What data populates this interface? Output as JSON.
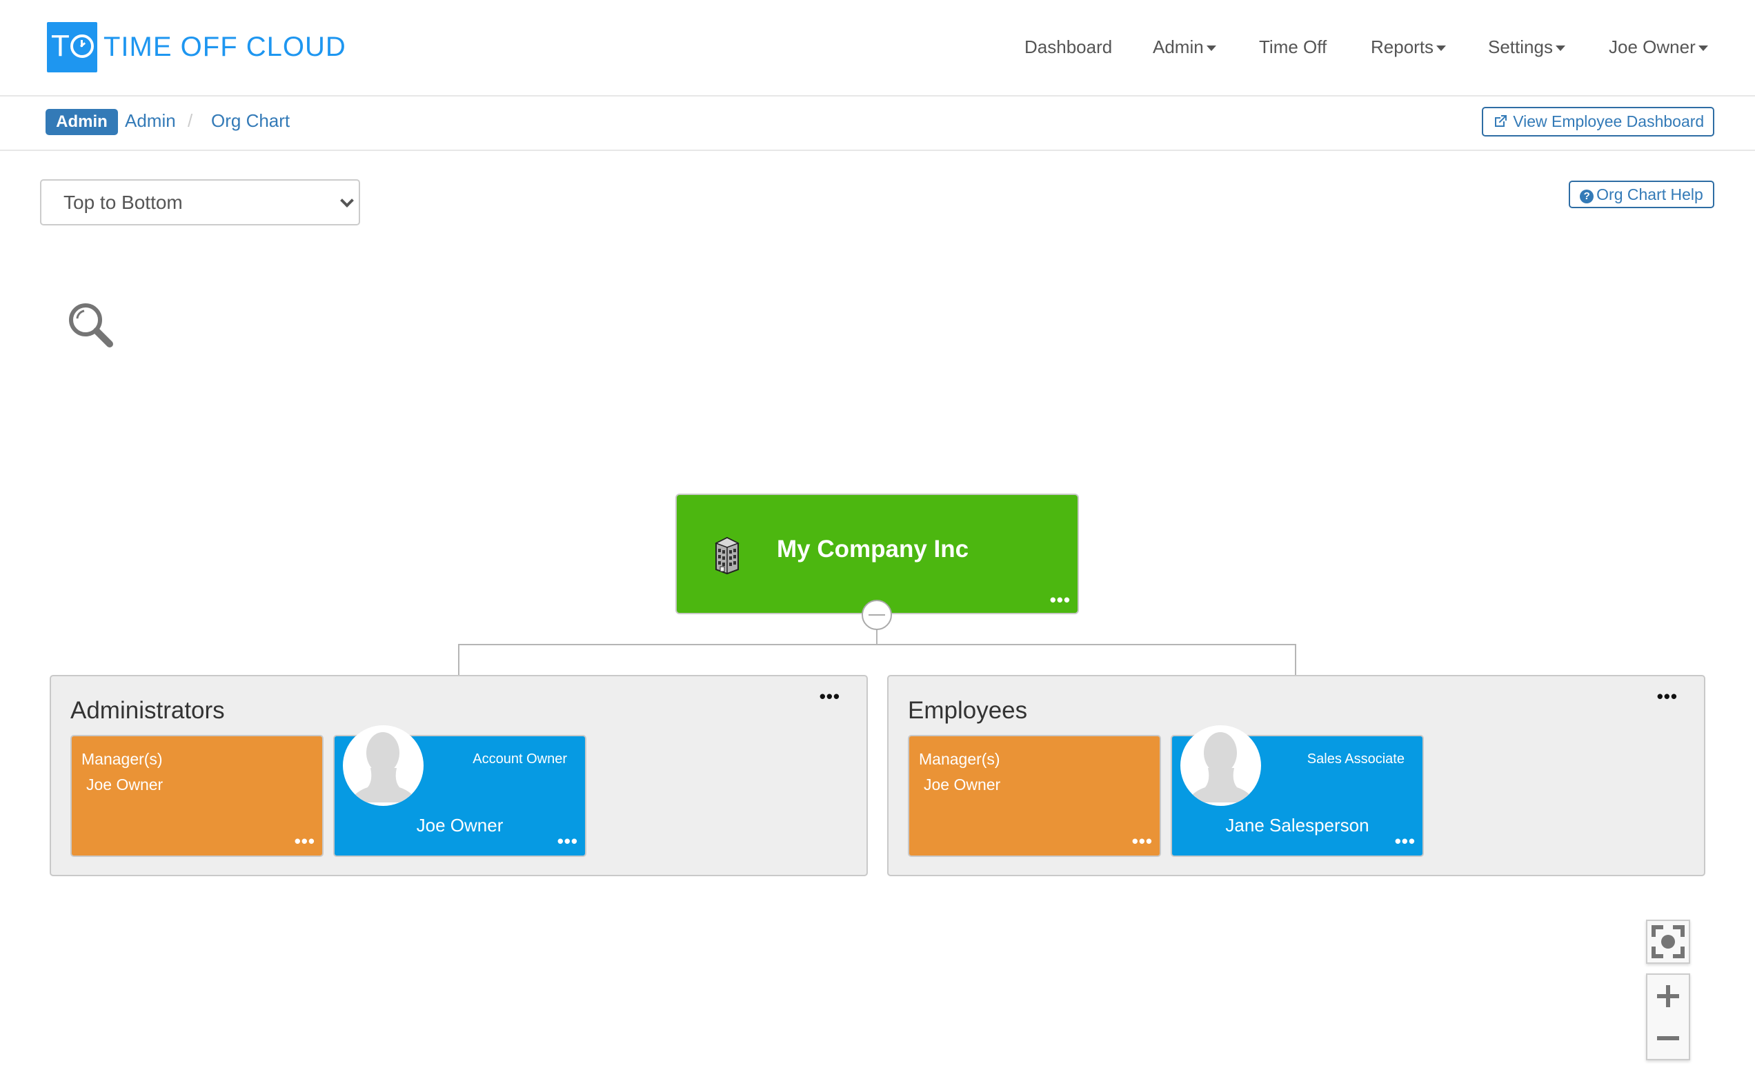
{
  "header": {
    "logo_text": "TIME OFF CLOUD",
    "logo_initial": "T",
    "brand_color": "#1e96f0",
    "nav": [
      {
        "label": "Dashboard",
        "dropdown": false
      },
      {
        "label": "Admin",
        "dropdown": true
      },
      {
        "label": "Time Off",
        "dropdown": false
      },
      {
        "label": "Reports",
        "dropdown": true
      },
      {
        "label": "Settings",
        "dropdown": true
      },
      {
        "label": "Joe Owner",
        "dropdown": true
      }
    ]
  },
  "breadcrumb": {
    "badge": "Admin",
    "items": [
      "Admin",
      "Org Chart"
    ],
    "separator": "/",
    "view_employee_dashboard": "View Employee Dashboard"
  },
  "toolbar": {
    "layout_select": {
      "selected": "Top to Bottom"
    },
    "help_button": "Org Chart Help"
  },
  "org_chart": {
    "root": {
      "name": "My Company Inc",
      "icon": "building-icon",
      "color": "#4cb710",
      "menu": "•••"
    },
    "groups": [
      {
        "title": "Administrators",
        "menu": "•••",
        "manager_card": {
          "label": "Manager(s)",
          "names": "Joe Owner",
          "menu": "•••",
          "color": "#ea9336"
        },
        "employees": [
          {
            "title": "Account Owner",
            "name": "Joe Owner",
            "menu": "•••",
            "color": "#069ae3"
          }
        ]
      },
      {
        "title": "Employees",
        "menu": "•••",
        "manager_card": {
          "label": "Manager(s)",
          "names": "Joe Owner",
          "menu": "•••",
          "color": "#ea9336"
        },
        "employees": [
          {
            "title": "Sales Associate",
            "name": "Jane Salesperson",
            "menu": "•••",
            "color": "#069ae3"
          }
        ]
      }
    ]
  },
  "zoom_controls": {
    "fit": "fit-screen-icon",
    "zoom_in": "plus-icon",
    "zoom_out": "minus-icon"
  }
}
